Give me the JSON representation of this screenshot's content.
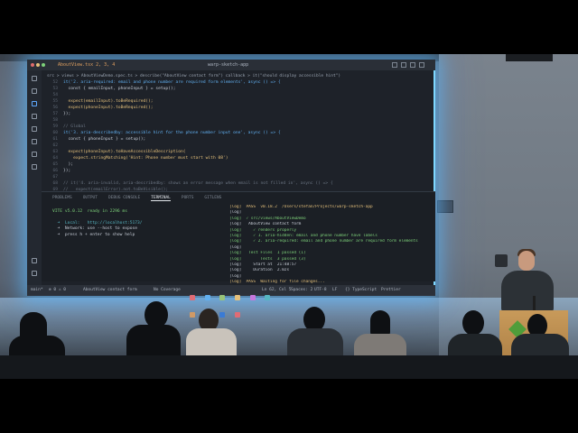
{
  "editor": {
    "tab_name": "AboutView.tsx  2, 3, 4",
    "window_title": "warp-sketch-app",
    "breadcrumb": "src > views > AboutViewDemo.spec.ts > describe(\"AboutView contact form\") callback > it(\"should display accessible hint\")",
    "code_lines": [
      "it('2. aria-required: email and phone number are required form elements', async () => {",
      "  const { emailInput, phoneInput } = setup();",
      "",
      "  expect(emailInput).toBeRequired();",
      "  expect(phoneInput).toBeRequired();",
      "});",
      "",
      "// Global",
      "it('3. aria-describedby: accessible hint for the phone number input one', async () => {",
      "  const { phoneInput } = setup();",
      "",
      "  expect(phoneInput).toHaveAccessibleDescription(",
      "    expect.stringMatching('Hint: Phone number must start with 08')",
      "  );",
      "});",
      "",
      "// it('4. aria-invalid, aria-describedby: shows an error message when email is not filled in', async () => {",
      "//   expect(emailError).not.toBeVisible();"
    ],
    "line_numbers": [
      "52",
      "53",
      "54",
      "55",
      "56",
      "57",
      "58",
      "59",
      "60",
      "61",
      "62",
      "63",
      "64",
      "65",
      "66",
      "67",
      "68",
      "69"
    ]
  },
  "panel": {
    "tabs": [
      "PROBLEMS",
      "OUTPUT",
      "DEBUG CONSOLE",
      "TERMINAL",
      "PORTS",
      "GITLENS"
    ],
    "active_tab": "TERMINAL",
    "left_terminal": [
      "VITE v5.0.12  ready in 2296 ms",
      "",
      "  ➜  Local:   http://localhost:5173/",
      "  ➜  Network: use --host to expose",
      "  ➜  press h + enter to show help"
    ],
    "right_terminal": [
      "[log]  PASS  v0.18.2  /Users/stefan/Projects/warp-sketch-app",
      "[log]",
      "[log]  ✓ src/views/AboutViewDemo",
      "[log]   AboutView contact form",
      "[log]     ✓ renders properly",
      "[log]     ✓ 1. aria-hidden: email and phone number have labels",
      "[log]     ✓ 2. aria-required: email and phone number are required form elements",
      "[log]",
      "[log]   Test Files  1 passed (1)",
      "[log]        Tests  3 passed (3)",
      "[log]     Start at  21:48:57",
      "[log]     Duration  2.02s",
      "[log]",
      "[log]  PASS  Waiting for file changes..."
    ]
  },
  "statusbar": {
    "items": [
      "main*",
      "⊗ 0 ⚠ 0",
      "AboutView contact form",
      "No Coverage",
      "Ln 62, Col 5",
      "Spaces: 2",
      "UTF-8",
      "LF",
      "{} TypeScript",
      "Prettier"
    ]
  },
  "colors": {
    "screen_glow": "#7fd8ff",
    "editor_bg": "#1e2229",
    "podium": "#c89a5a",
    "podium_logo": "#4f9d3a"
  }
}
